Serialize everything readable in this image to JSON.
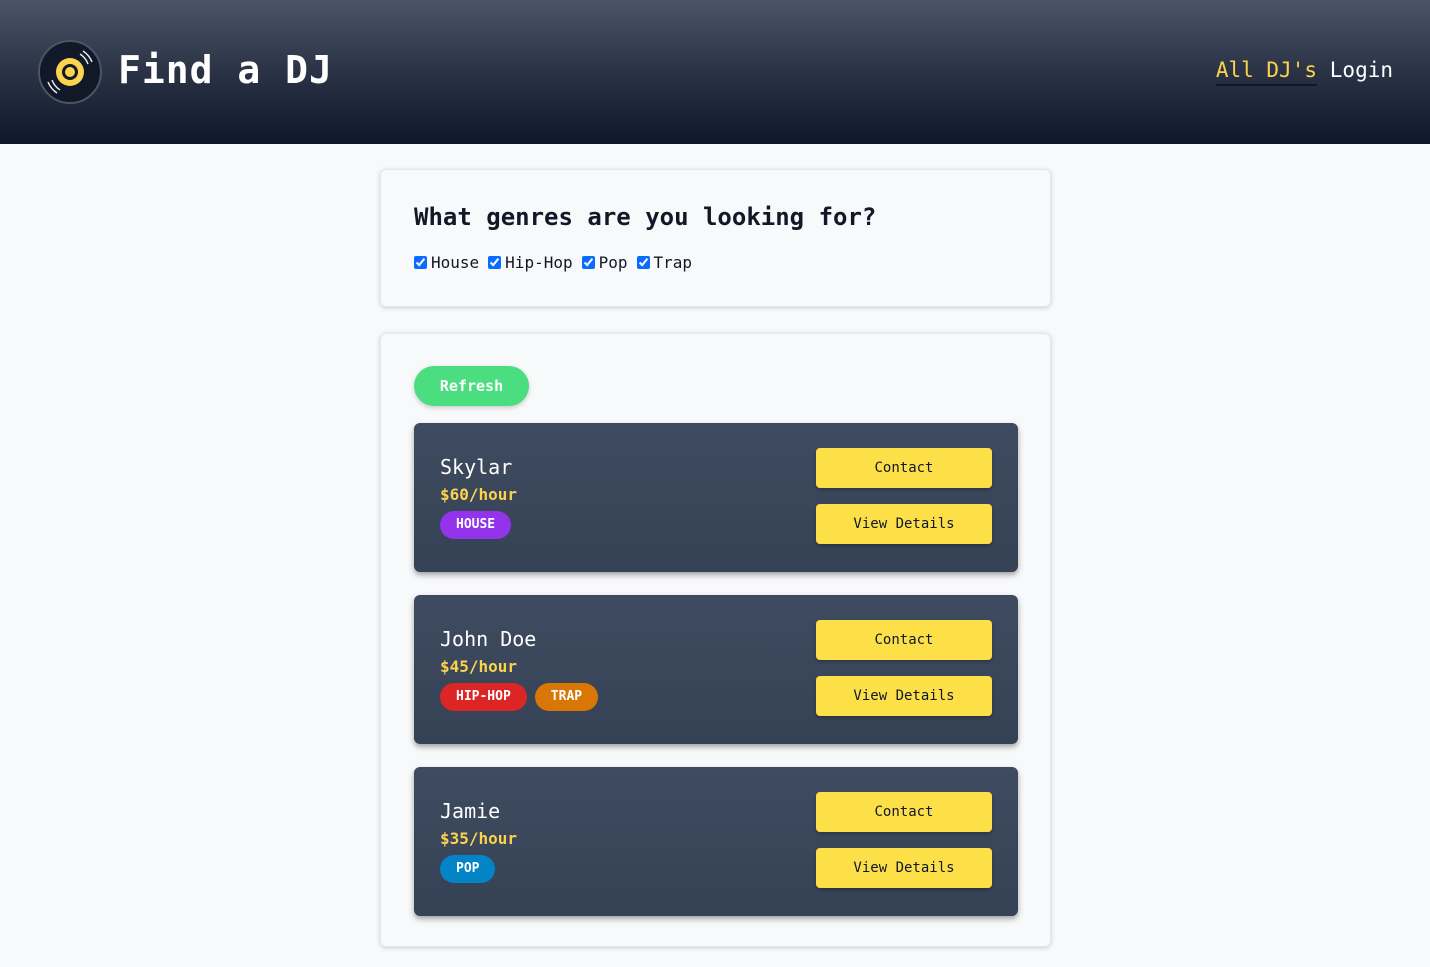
{
  "header": {
    "title": "Find a DJ",
    "nav": {
      "all_djs": "All DJ's",
      "login": "Login"
    }
  },
  "filter": {
    "title": "What genres are you looking for?",
    "genres": [
      {
        "label": "House",
        "checked": true
      },
      {
        "label": "Hip-Hop",
        "checked": true
      },
      {
        "label": "Pop",
        "checked": true
      },
      {
        "label": "Trap",
        "checked": true
      }
    ]
  },
  "list": {
    "refresh_label": "Refresh",
    "contact_label": "Contact",
    "details_label": "View Details",
    "djs": [
      {
        "name": "Skylar",
        "rate": "$60/hour",
        "tags": [
          {
            "label": "HOUSE",
            "color": "#9333ea"
          }
        ]
      },
      {
        "name": "John Doe",
        "rate": "$45/hour",
        "tags": [
          {
            "label": "HIP-HOP",
            "color": "#dc2626"
          },
          {
            "label": "TRAP",
            "color": "#d97706"
          }
        ]
      },
      {
        "name": "Jamie",
        "rate": "$35/hour",
        "tags": [
          {
            "label": "POP",
            "color": "#0284c7"
          }
        ]
      }
    ]
  },
  "colors": {
    "accent_yellow": "#fde047",
    "refresh_green": "#4ade80",
    "card_bg": "#3f4b60"
  }
}
